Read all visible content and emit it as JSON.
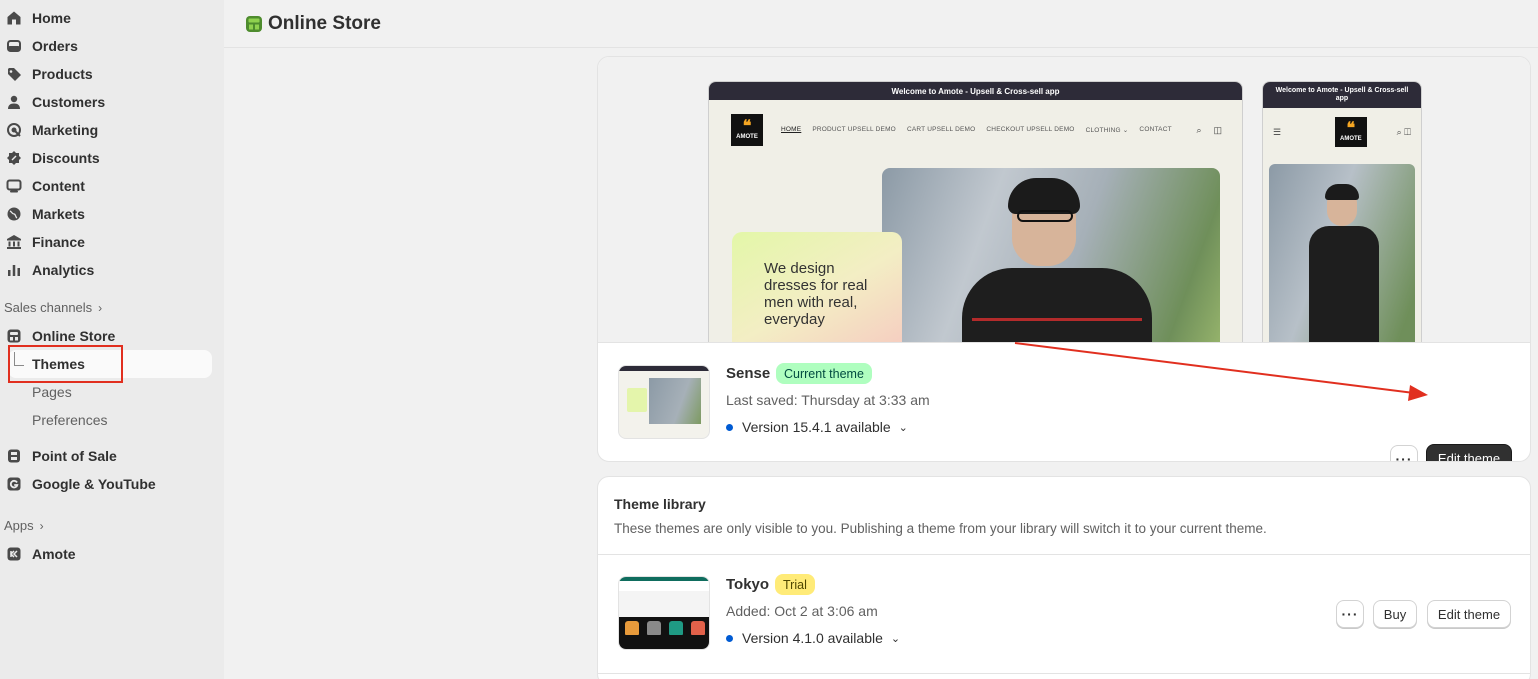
{
  "sidebar": {
    "items": [
      {
        "label": "Home",
        "icon": "home-icon"
      },
      {
        "label": "Orders",
        "icon": "orders-icon"
      },
      {
        "label": "Products",
        "icon": "tag-icon"
      },
      {
        "label": "Customers",
        "icon": "person-icon"
      },
      {
        "label": "Marketing",
        "icon": "target-icon"
      },
      {
        "label": "Discounts",
        "icon": "discount-icon"
      },
      {
        "label": "Content",
        "icon": "content-icon"
      },
      {
        "label": "Markets",
        "icon": "globe-icon"
      },
      {
        "label": "Finance",
        "icon": "bank-icon"
      },
      {
        "label": "Analytics",
        "icon": "bar-chart-icon"
      }
    ],
    "sales_channels_label": "Sales channels",
    "online_store_label": "Online Store",
    "sub_items": [
      {
        "label": "Themes",
        "active": true
      },
      {
        "label": "Pages",
        "active": false
      },
      {
        "label": "Preferences",
        "active": false
      }
    ],
    "point_of_sale_label": "Point of Sale",
    "google_label": "Google & YouTube",
    "apps_label": "Apps",
    "amote_label": "Amote"
  },
  "header": {
    "title": "Online Store"
  },
  "preview": {
    "desktop_announcement": "Welcome to Amote - Upsell & Cross-sell app",
    "mobile_announcement": "Welcome to Amote - Upsell & Cross-sell app",
    "logo_text": "AMOTE",
    "menu": [
      "HOME",
      "PRODUCT UPSELL DEMO",
      "CART UPSELL DEMO",
      "CHECKOUT UPSELL DEMO",
      "CLOTHING ⌄",
      "CONTACT"
    ],
    "hero_text": "We design dresses for real men with real, everyday"
  },
  "current_theme": {
    "name": "Sense",
    "badge": "Current theme",
    "last_saved": "Last saved: Thursday at 3:33 am",
    "version": "Version 15.4.1 available",
    "more_label": "···",
    "edit_label": "Edit theme"
  },
  "library": {
    "title": "Theme library",
    "description": "These themes are only visible to you. Publishing a theme from your library will switch it to your current theme.",
    "themes": [
      {
        "name": "Tokyo",
        "badge": "Trial",
        "added": "Added: Oct 2 at 3:06 am",
        "version": "Version 4.1.0 available",
        "more_label": "···",
        "buy_label": "Buy",
        "edit_label": "Edit theme"
      }
    ]
  },
  "colors": {
    "accent_dark": "#303030",
    "badge_green": "#affebf",
    "badge_yellow": "#ffeb78",
    "annotation_red": "#e12f1f",
    "version_dot": "#005bd3"
  }
}
